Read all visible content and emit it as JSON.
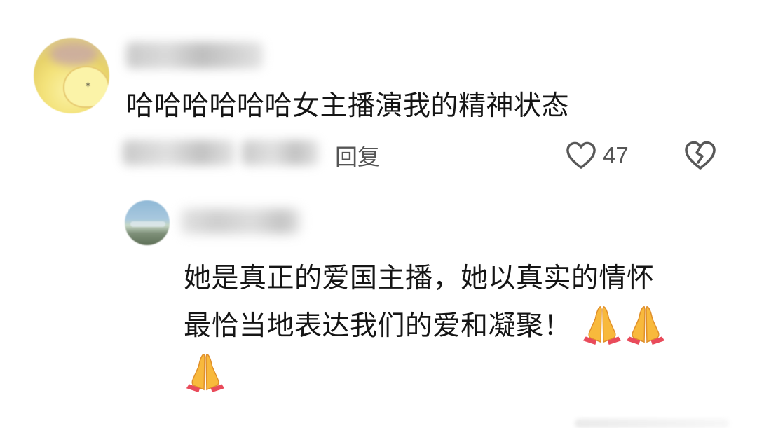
{
  "comment": {
    "text": "哈哈哈哈哈哈女主播演我的精神状态",
    "reply_label": "回复",
    "like_count": "47",
    "icons": {
      "like": "heart-outline-icon",
      "dislike": "broken-heart-icon"
    }
  },
  "reply": {
    "line1": "她是真正的爱国主播，她以真实的情怀",
    "line2": "最恰当地表达我们的爱和凝聚！",
    "emoji": "folded-hands-emoji",
    "emoji_count": 3
  },
  "colors": {
    "text": "#151515",
    "secondary": "#555555",
    "emoji": "#F7B63A"
  }
}
